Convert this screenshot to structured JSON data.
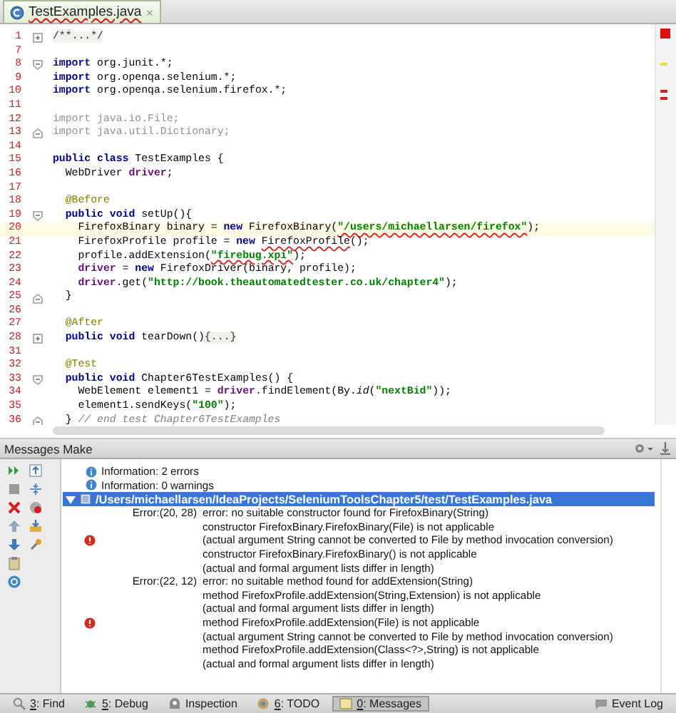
{
  "editor_tab": {
    "title": "TestExamples.java",
    "has_errors": true,
    "close": "×",
    "selected": true
  },
  "editor": {
    "lines": [
      {
        "number": "1",
        "current": false,
        "fold": {
          "kind": "collapsed"
        },
        "tokens": [
          {
            "text": "/**...*/",
            "kind": "folded"
          }
        ]
      },
      {
        "number": "7",
        "current": false
      },
      {
        "number": "8",
        "current": false,
        "fold": {
          "kind": "start"
        },
        "tokens": [
          {
            "text": "import",
            "kind": "kw"
          },
          {
            "text": " org.junit.*;",
            "kind": "plain"
          }
        ]
      },
      {
        "number": "9",
        "current": false,
        "tokens": [
          {
            "text": "import",
            "kind": "kw"
          },
          {
            "text": " org.openqa.selenium.*;",
            "kind": "plain"
          }
        ]
      },
      {
        "number": "10",
        "current": false,
        "tokens": [
          {
            "text": "import",
            "kind": "kw"
          },
          {
            "text": " org.openqa.selenium.firefox.*;",
            "kind": "plain"
          }
        ]
      },
      {
        "number": "11",
        "current": false
      },
      {
        "number": "12",
        "current": false,
        "tokens": [
          {
            "text": "import java.io.File;",
            "kind": "unused"
          }
        ]
      },
      {
        "number": "13",
        "current": false,
        "fold": {
          "kind": "end"
        },
        "tokens": [
          {
            "text": "import java.util.Dictionary;",
            "kind": "unused"
          }
        ]
      },
      {
        "number": "14",
        "current": false
      },
      {
        "number": "15",
        "current": false,
        "tokens": [
          {
            "text": "public class",
            "kind": "kw"
          },
          {
            "text": " TestExamples {",
            "kind": "plain"
          }
        ]
      },
      {
        "number": "16",
        "current": false,
        "tokens": [
          {
            "text": "  WebDriver ",
            "kind": "plain"
          },
          {
            "text": "driver",
            "kind": "field"
          },
          {
            "text": ";",
            "kind": "plain"
          }
        ]
      },
      {
        "number": "17",
        "current": false
      },
      {
        "number": "18",
        "current": false,
        "tokens": [
          {
            "text": "  @Before",
            "kind": "ann"
          }
        ]
      },
      {
        "number": "19",
        "current": false,
        "fold": {
          "kind": "start"
        },
        "tokens": [
          {
            "text": "  public void",
            "kind": "kw"
          },
          {
            "text": " setUp(){",
            "kind": "plain"
          }
        ]
      },
      {
        "number": "20",
        "current": true,
        "tokens": [
          {
            "text": "    FirefoxBinary binary = ",
            "kind": "plain"
          },
          {
            "text": "new",
            "kind": "kw"
          },
          {
            "text": " FirefoxBinary(",
            "kind": "plain"
          },
          {
            "text": "\"/users/michaellarsen/firefox\"",
            "kind": "str-err"
          },
          {
            "text": ");",
            "kind": "plain"
          }
        ]
      },
      {
        "number": "21",
        "current": false,
        "tokens": [
          {
            "text": "    FirefoxProfile profile = ",
            "kind": "plain"
          },
          {
            "text": "new ",
            "kind": "kw"
          },
          {
            "text": "FirefoxProfile",
            "kind": "err"
          },
          {
            "text": "();",
            "kind": "plain"
          }
        ]
      },
      {
        "number": "22",
        "current": false,
        "tokens": [
          {
            "text": "    profile.addExtension(",
            "kind": "plain"
          },
          {
            "text": "\"firebug.xpi\"",
            "kind": "str-err"
          },
          {
            "text": ");",
            "kind": "plain"
          }
        ]
      },
      {
        "number": "23",
        "current": false,
        "tokens": [
          {
            "text": "    driver",
            "kind": "field"
          },
          {
            "text": " = ",
            "kind": "plain"
          },
          {
            "text": "new",
            "kind": "kw"
          },
          {
            "text": " FirefoxDriver(binary, profile);",
            "kind": "plain"
          }
        ]
      },
      {
        "number": "24",
        "current": false,
        "tokens": [
          {
            "text": "    driver",
            "kind": "field"
          },
          {
            "text": ".get(",
            "kind": "plain"
          },
          {
            "text": "\"http://book.theautomatedtester.co.uk/chapter4\"",
            "kind": "str"
          },
          {
            "text": ");",
            "kind": "plain"
          }
        ]
      },
      {
        "number": "25",
        "current": false,
        "fold": {
          "kind": "end"
        },
        "tokens": [
          {
            "text": "  }",
            "kind": "plain"
          }
        ]
      },
      {
        "number": "26",
        "current": false
      },
      {
        "number": "27",
        "current": false,
        "tokens": [
          {
            "text": "  @After",
            "kind": "ann"
          }
        ]
      },
      {
        "number": "28",
        "current": false,
        "fold": {
          "kind": "collapsed"
        },
        "tokens": [
          {
            "text": "  public void",
            "kind": "kw"
          },
          {
            "text": " tearDown()",
            "kind": "plain"
          },
          {
            "text": "{...}",
            "kind": "folded"
          }
        ]
      },
      {
        "number": "31",
        "current": false
      },
      {
        "number": "32",
        "current": false,
        "tokens": [
          {
            "text": "  @Test",
            "kind": "ann"
          }
        ]
      },
      {
        "number": "33",
        "current": false,
        "fold": {
          "kind": "start"
        },
        "tokens": [
          {
            "text": "  public void",
            "kind": "kw"
          },
          {
            "text": " Chapter6TestExamples() {",
            "kind": "plain"
          }
        ]
      },
      {
        "number": "34",
        "current": false,
        "tokens": [
          {
            "text": "    WebElement element1 = ",
            "kind": "plain"
          },
          {
            "text": "driver",
            "kind": "field"
          },
          {
            "text": ".findElement(By.",
            "kind": "plain"
          },
          {
            "text": "id",
            "kind": "italic"
          },
          {
            "text": "(",
            "kind": "plain"
          },
          {
            "text": "\"nextBid\"",
            "kind": "str"
          },
          {
            "text": "));",
            "kind": "plain"
          }
        ]
      },
      {
        "number": "35",
        "current": false,
        "tokens": [
          {
            "text": "    element1.sendKeys(",
            "kind": "plain"
          },
          {
            "text": "\"100\"",
            "kind": "str"
          },
          {
            "text": ");",
            "kind": "plain"
          }
        ]
      },
      {
        "number": "36",
        "current": false,
        "fold": {
          "kind": "end"
        },
        "tokens": [
          {
            "text": "  } ",
            "kind": "plain"
          },
          {
            "text": "// end test Chapter6TestExamples",
            "kind": "comment"
          }
        ]
      }
    ]
  },
  "messages": {
    "title": "Messages Make",
    "info": [
      {
        "text": "Information: 2 errors"
      },
      {
        "text": "Information: 0 warnings"
      }
    ],
    "file": {
      "path": "/Users/michaellarsen/IdeaProjects/SeleniumToolsChapter5/test/TestExamples.java",
      "expanded": true,
      "selected": true
    },
    "errors": [
      {
        "location": "Error:(20, 28)",
        "lines": [
          "error: no suitable constructor found for FirefoxBinary(String)",
          "constructor FirefoxBinary.FirefoxBinary(File) is not applicable",
          "(actual argument String cannot be converted to File by method invocation conversion)",
          "constructor FirefoxBinary.FirefoxBinary() is not applicable",
          "(actual and formal argument lists differ in length)"
        ]
      },
      {
        "location": "Error:(22, 12)",
        "lines": [
          "error: no suitable method found for addExtension(String)",
          "method FirefoxProfile.addExtension(String,Extension) is not applicable",
          "(actual and formal argument lists differ in length)",
          "method FirefoxProfile.addExtension(File) is not applicable",
          "(actual argument String cannot be converted to File by method invocation conversion)",
          "method FirefoxProfile.addExtension(Class<?>,String) is not applicable",
          "(actual and formal argument lists differ in length)"
        ]
      }
    ]
  },
  "tool_windows": [
    {
      "key": "3",
      "label": ": Find",
      "kind": "find",
      "selected": false
    },
    {
      "key": "5",
      "label": ": Debug",
      "kind": "debug",
      "selected": false
    },
    {
      "label": "Inspection",
      "kind": "inspection",
      "selected": false
    },
    {
      "key": "6",
      "label": ": TODO",
      "kind": "todo",
      "selected": false
    },
    {
      "key": "0",
      "label": ": Messages",
      "kind": "messages",
      "selected": true
    }
  ],
  "event_log": {
    "label": "Event Log"
  }
}
